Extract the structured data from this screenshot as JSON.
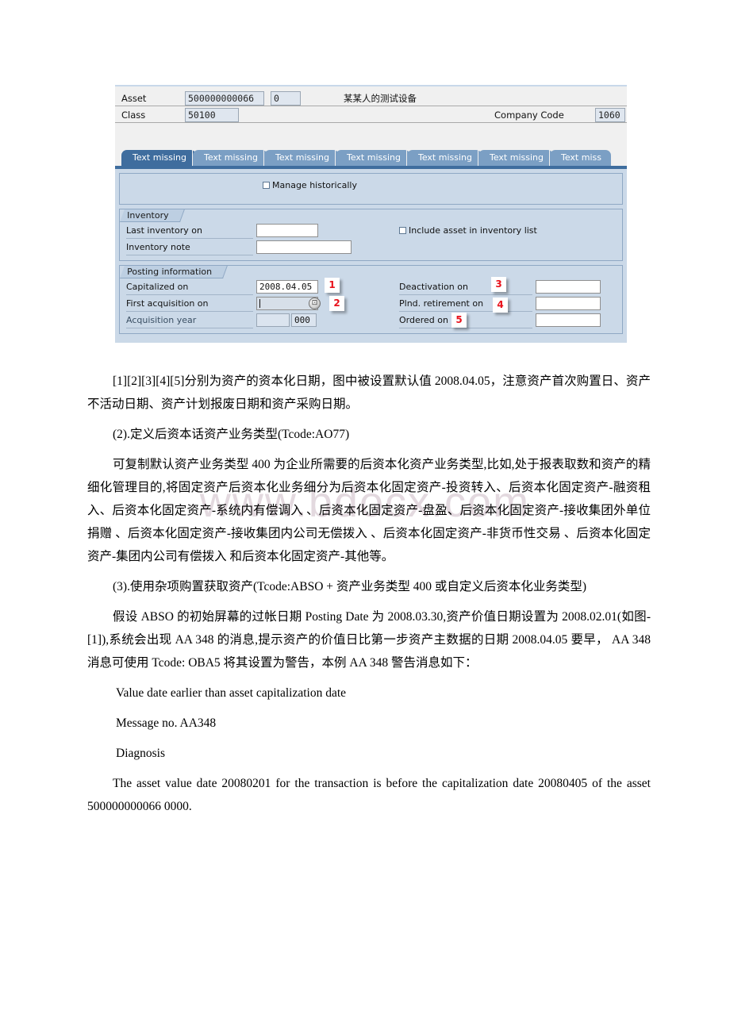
{
  "sap_form": {
    "header": {
      "asset_label": "Asset",
      "asset_value": "500000000066",
      "asset_sub_value": "0",
      "asset_description": "某某人的测试设备",
      "class_label": "Class",
      "class_value": "50100",
      "company_code_label": "Company Code",
      "company_code_value": "1060"
    },
    "tabs": [
      {
        "label": "Text missing",
        "active": true
      },
      {
        "label": "Text missing",
        "active": false
      },
      {
        "label": "Text missing",
        "active": false
      },
      {
        "label": "Text missing",
        "active": false
      },
      {
        "label": "Text missing",
        "active": false
      },
      {
        "label": "Text missing",
        "active": false
      },
      {
        "label": "Text miss",
        "active": false
      }
    ],
    "manage_historically": {
      "label": "Manage historically",
      "checked": false
    },
    "inventory": {
      "group_title": "Inventory",
      "last_inventory_label": "Last inventory on",
      "last_inventory_value": "",
      "inventory_note_label": "Inventory note",
      "inventory_note_value": "",
      "include_asset_label": "Include asset in inventory list",
      "include_asset_checked": false
    },
    "posting_information": {
      "group_title": "Posting information",
      "capitalized_on_label": "Capitalized on",
      "capitalized_on_value": "2008.04.05",
      "first_acquisition_label": "First acquisition on",
      "first_acquisition_value": "",
      "acquisition_year_label": "Acquisition year",
      "acquisition_year_value": "",
      "acquisition_period_value": "000",
      "deactivation_label": "Deactivation on",
      "deactivation_value": "",
      "plnd_retirement_label": "Plnd. retirement on",
      "plnd_retirement_value": "",
      "ordered_on_label": "Ordered on",
      "ordered_on_value": "",
      "f4_icon": "search-help-icon"
    },
    "callouts": [
      {
        "number": "1"
      },
      {
        "number": "2"
      },
      {
        "number": "3"
      },
      {
        "number": "4"
      },
      {
        "number": "5"
      }
    ],
    "colors": {
      "panel_bg": "#cbd9e8",
      "tab_active": "#3f6d9e",
      "tab_inactive": "#7b9fc4",
      "callout_red": "#e8121b"
    }
  },
  "watermark": {
    "text": "www.bdocx.com"
  },
  "document": {
    "paragraphs": [
      {
        "id": "p-callout-legend",
        "text": "[1][2][3][4][5]分别为资产的资本化日期，图中被设置默认值 2008.04.05，注意资产首次购置日、资产不活动日期、资产计划报废日期和资产采购日期。"
      },
      {
        "id": "p-section-2",
        "text": "(2).定义后资本话资产业务类型(Tcode:AO77)"
      },
      {
        "id": "p-section-2-body",
        "text": "可复制默认资产业务类型 400 为企业所需要的后资本化资产业务类型,比如,处于报表取数和资产的精细化管理目的,将固定资产后资本化业务细分为后资本化固定资产-投资转入、后资本化固定资产-融资租入、后资本化固定资产-系统内有偿调入 、后资本化固定资产-盘盈、后资本化固定资产-接收集团外单位捐赠 、后资本化固定资产-接收集团内公司无偿拨入 、后资本化固定资产-非货币性交易 、后资本化固定资产-集团内公司有偿拨入 和后资本化固定资产-其他等。"
      },
      {
        "id": "p-section-3",
        "text": "(3).使用杂项购置获取资产(Tcode:ABSO + 资产业务类型 400 或自定义后资本化业务类型)"
      },
      {
        "id": "p-section-3-body",
        "text": "假设 ABSO 的初始屏幕的过帐日期 Posting Date 为 2008.03.30,资产价值日期设置为 2008.02.01(如图-[1]),系统会出现 AA 348 的消息,提示资产的价值日比第一步资产主数据的日期 2008.04.05 要早， AA 348 消息可使用 Tcode: OBA5 将其设置为警告，本例 AA 348 警告消息如下："
      },
      {
        "id": "p-msg-title",
        "text": "Value date earlier than asset capitalization date"
      },
      {
        "id": "p-msg-no",
        "text": "Message no. AA348"
      },
      {
        "id": "p-msg-diagnosis",
        "text": "Diagnosis"
      },
      {
        "id": "p-msg-body",
        "text": "The asset value date 20080201 for the transaction is before the capitalization date 20080405 of the asset 500000000066 0000."
      }
    ]
  }
}
